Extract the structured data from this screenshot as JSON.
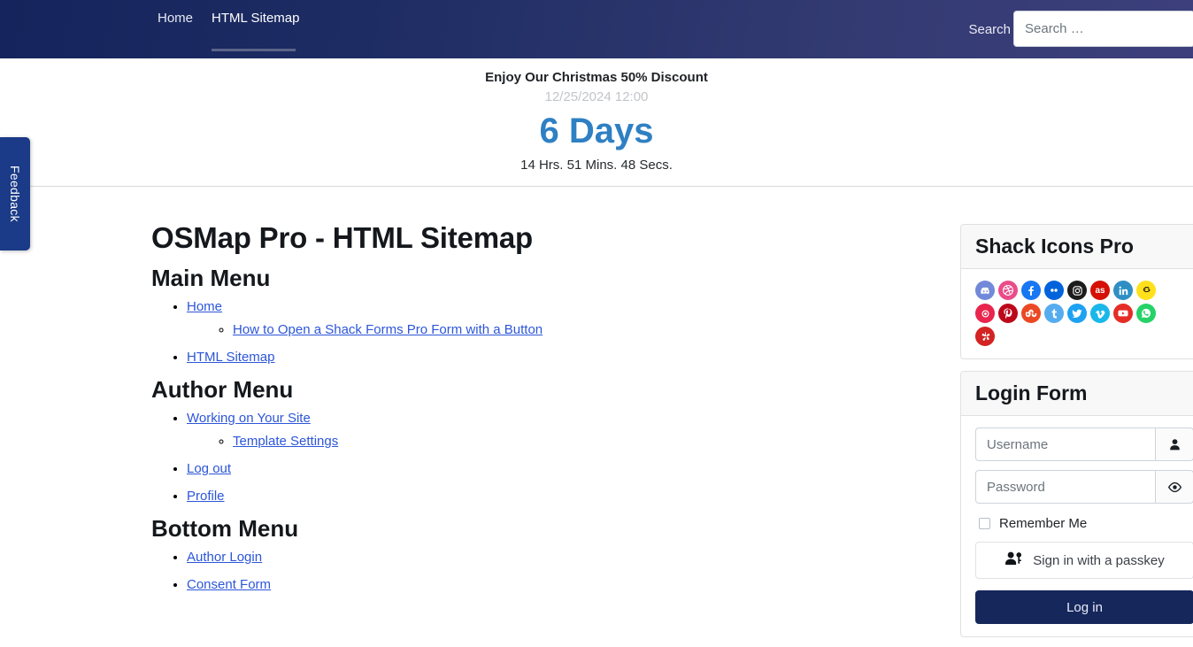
{
  "header": {
    "nav_items": [
      {
        "label": "Home",
        "active": false
      },
      {
        "label": "HTML Sitemap",
        "active": true
      }
    ],
    "search_label": "Search",
    "search_placeholder": "Search …",
    "search_value": ""
  },
  "countdown": {
    "title": "Enjoy Our Christmas 50% Discount",
    "date": "12/25/2024 12:00",
    "days": "6 Days",
    "time": "14 Hrs. 51 Mins. 48 Secs.",
    "days_color": "#2f80c3"
  },
  "feedback": {
    "label": "Feedback",
    "color": "#1b3a87"
  },
  "main": {
    "page_title": "OSMap Pro - HTML Sitemap",
    "sections": [
      {
        "heading": "Main Menu",
        "items": [
          {
            "label": "Home",
            "children": [
              {
                "label": "How to Open a Shack Forms Pro Form with a Button"
              }
            ]
          },
          {
            "label": "HTML Sitemap",
            "children": []
          }
        ]
      },
      {
        "heading": "Author Menu",
        "items": [
          {
            "label": "Working on Your Site",
            "children": [
              {
                "label": "Template Settings"
              }
            ]
          },
          {
            "label": "Log out",
            "children": []
          },
          {
            "label": "Profile",
            "children": []
          }
        ]
      },
      {
        "heading": "Bottom Menu",
        "items": [
          {
            "label": "Author Login",
            "children": []
          },
          {
            "label": "Consent Form",
            "children": []
          }
        ]
      }
    ],
    "link_color": "#2c56d8"
  },
  "sidebar": {
    "shack_icons": {
      "title": "Shack Icons Pro",
      "icons": [
        {
          "name": "discord-icon",
          "color": "#7289da"
        },
        {
          "name": "dribbble-icon",
          "color": "#ea4c89"
        },
        {
          "name": "facebook-icon",
          "color": "#1877f2"
        },
        {
          "name": "flickr-icon",
          "color": "#0063dc"
        },
        {
          "name": "instagram-icon",
          "color": "#1c1c1c"
        },
        {
          "name": "lastfm-icon",
          "color": "#d51007"
        },
        {
          "name": "linkedin-icon",
          "color": "#2f8fc4"
        },
        {
          "name": "mailchimp-icon",
          "color": "#ffe01b"
        },
        {
          "name": "mixcloud-icon",
          "color": "#e9254d"
        },
        {
          "name": "pinterest-icon",
          "color": "#bd081c"
        },
        {
          "name": "stumbleupon-icon",
          "color": "#eb4924"
        },
        {
          "name": "tumblr-icon",
          "color": "#55acee"
        },
        {
          "name": "twitter-icon",
          "color": "#1da1f2"
        },
        {
          "name": "vimeo-icon",
          "color": "#1ab7ea"
        },
        {
          "name": "youtube-icon",
          "color": "#e52d27"
        },
        {
          "name": "whatsapp-icon",
          "color": "#25d366"
        },
        {
          "name": "yelp-icon",
          "color": "#d32323"
        }
      ]
    },
    "login_form": {
      "title": "Login Form",
      "username_placeholder": "Username",
      "username_value": "",
      "password_placeholder": "Password",
      "password_value": "",
      "remember_label": "Remember Me",
      "remember_checked": false,
      "passkey_label": "Sign in with a passkey",
      "login_label": "Log in",
      "button_color": "#16275c"
    }
  }
}
